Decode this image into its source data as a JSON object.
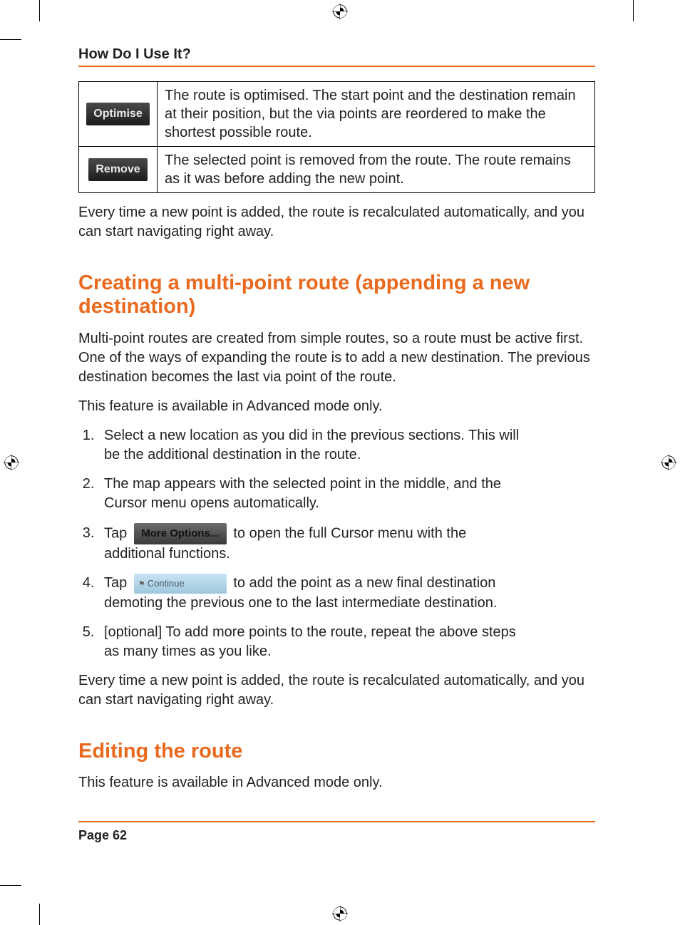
{
  "header": {
    "running_title": "How Do I Use It?"
  },
  "table": {
    "rows": [
      {
        "button_label": "Optimise",
        "description": "The route is optimised. The start point and the destination remain at their position, but the via points are reordered to make the shortest possible route."
      },
      {
        "button_label": "Remove",
        "description": "The selected point is removed from the route. The route remains as it was before adding the new point."
      }
    ]
  },
  "para_after_table": "Every time a new point is added, the route is recalculated automatically, and you can start navigating right away.",
  "section1": {
    "title": "Creating a multi-point route (appending a new destination)",
    "intro": "Multi-point routes are created from simple routes, so a route must be active first. One of the ways of expanding the route is to add a new destination. The previous destination becomes the last via point of the route.",
    "note": "This feature is available in Advanced mode only.",
    "step1": "Select a new location as you did in the previous sections. This will be the additional destination in the route.",
    "step2": "The map appears with the selected point in the middle, and the Cursor menu opens automatically.",
    "step3_pre": "Tap ",
    "step3_btn": "More Options...",
    "step3_post": " to open the full Cursor menu with the additional functions.",
    "step4_pre": "Tap ",
    "step4_btn": "Continue",
    "step4_post": " to add the point as a new final destination demoting the previous one to the last intermediate destination.",
    "step5": "[optional] To add more points to the route, repeat the above steps as many times as you like.",
    "outro": "Every time a new point is added, the route is recalculated automatically, and you can start navigating right away."
  },
  "section2": {
    "title": "Editing the route",
    "note": "This feature is available in Advanced mode only."
  },
  "footer": {
    "page_label": "Page 62"
  }
}
